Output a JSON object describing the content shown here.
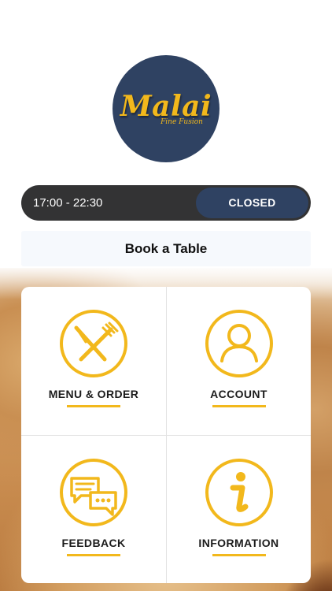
{
  "logo": {
    "name": "Malai",
    "tagline": "Fine Fusion"
  },
  "hours": {
    "range": "17:00 - 22:30",
    "status": "CLOSED"
  },
  "book_button": {
    "label": "Book a Table"
  },
  "tiles": [
    {
      "label": "MENU & ORDER",
      "icon": "fork-knife-icon"
    },
    {
      "label": "ACCOUNT",
      "icon": "user-icon"
    },
    {
      "label": "FEEDBACK",
      "icon": "chat-bubbles-icon"
    },
    {
      "label": "INFORMATION",
      "icon": "info-icon"
    }
  ],
  "colors": {
    "accent": "#f2b81c",
    "navy": "#2f4262",
    "bar": "#333334"
  }
}
